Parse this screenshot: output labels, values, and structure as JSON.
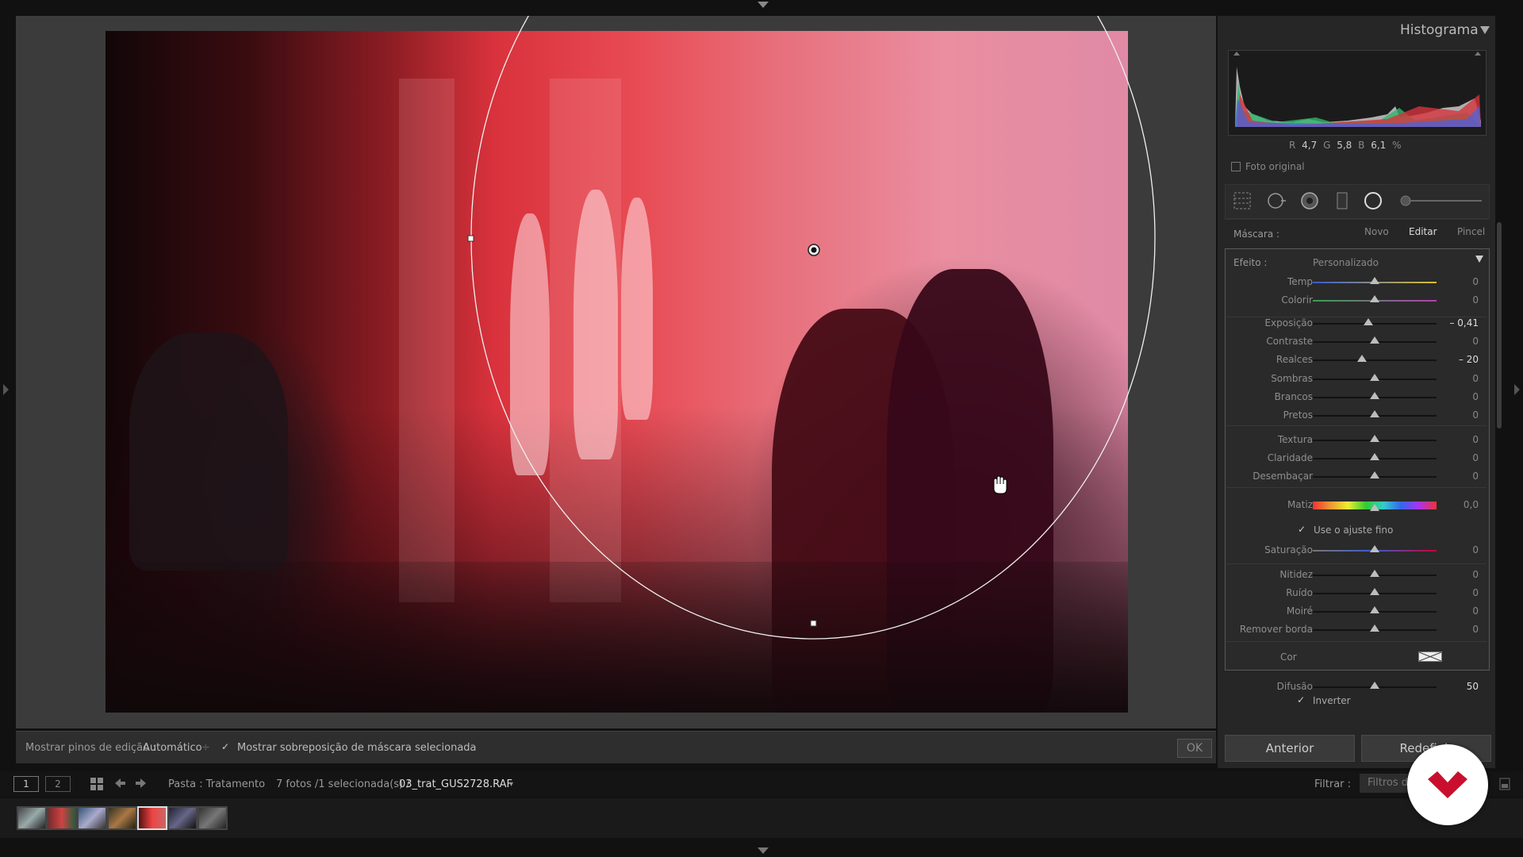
{
  "histogram": {
    "title": "Histograma",
    "r_label": "R",
    "r_value": "4,7",
    "g_label": "G",
    "g_value": "5,8",
    "b_label": "B",
    "b_value": "6,1",
    "percent": "%",
    "original_photo_label": "Foto original"
  },
  "mask": {
    "label": "Máscara :",
    "tabs": [
      "Novo",
      "Editar",
      "Pincel"
    ],
    "active_tab": "Editar"
  },
  "effect": {
    "label": "Efeito :",
    "preset": "Personalizado",
    "sliders": [
      {
        "label": "Temp",
        "value": "0",
        "pos": 0.5
      },
      {
        "label": "Colorir",
        "value": "0",
        "pos": 0.5
      },
      {
        "label": "Exposição",
        "value": "– 0,41",
        "pos": 0.45
      },
      {
        "label": "Contraste",
        "value": "0",
        "pos": 0.5
      },
      {
        "label": "Realces",
        "value": "– 20",
        "pos": 0.4
      },
      {
        "label": "Sombras",
        "value": "0",
        "pos": 0.5
      },
      {
        "label": "Brancos",
        "value": "0",
        "pos": 0.5
      },
      {
        "label": "Pretos",
        "value": "0",
        "pos": 0.5
      },
      {
        "label": "Textura",
        "value": "0",
        "pos": 0.5
      },
      {
        "label": "Claridade",
        "value": "0",
        "pos": 0.5
      },
      {
        "label": "Desembaçar",
        "value": "0",
        "pos": 0.5
      },
      {
        "label": "Matiz",
        "value": "0,0",
        "pos": 0.5
      },
      {
        "label": "Saturação",
        "value": "0",
        "pos": 0.5
      },
      {
        "label": "Nitidez",
        "value": "0",
        "pos": 0.5
      },
      {
        "label": "Ruído",
        "value": "0",
        "pos": 0.5
      },
      {
        "label": "Moiré",
        "value": "0",
        "pos": 0.5
      },
      {
        "label": "Remover borda",
        "value": "0",
        "pos": 0.5
      },
      {
        "label": "Difusão",
        "value": "50",
        "pos": 0.5
      }
    ],
    "fine_adjust_label": "Use o ajuste fino",
    "color_label": "Cor",
    "invert_label": "Inverter"
  },
  "buttons": {
    "previous": "Anterior",
    "reset": "Redefinir",
    "ok": "OK"
  },
  "toolbar": {
    "show_pins_label": "Mostrar pinos de edição :",
    "show_pins_value": "Automático",
    "show_overlay_label": "Mostrar sobreposição de máscara selecionada"
  },
  "filmbar": {
    "view1": "1",
    "view2": "2",
    "folder": "Pasta : Tratamento",
    "count": "7 fotos /1 selecionada(s) /",
    "filename": "03_trat_GUS2728.RAF",
    "filter_label": "Filtrar :",
    "filter_value": "Filtros d"
  },
  "colors": {
    "mask_overlay": "#e8404c",
    "logo_red": "#c8102e"
  }
}
